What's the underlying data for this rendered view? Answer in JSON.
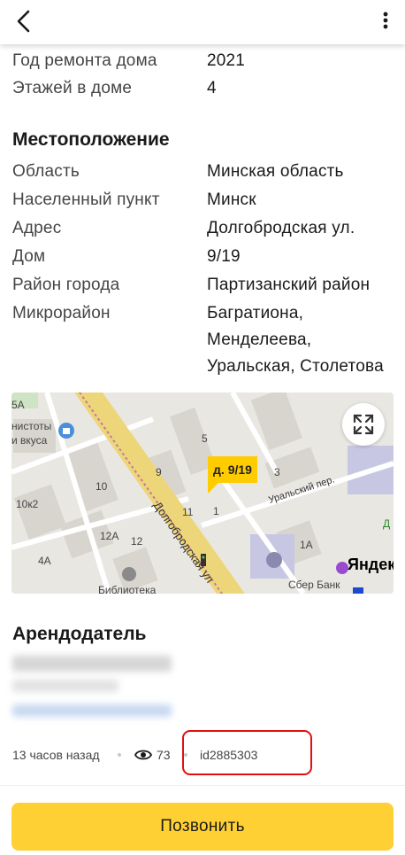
{
  "building": {
    "repair_label": "Год ремонта дома",
    "repair_value": "2021",
    "floors_label": "Этажей в доме",
    "floors_value": "4"
  },
  "location": {
    "title": "Местоположение",
    "rows": [
      {
        "label": "Область",
        "value": "Минская область"
      },
      {
        "label": "Населенный пункт",
        "value": "Минск"
      },
      {
        "label": "Адрес",
        "value": "Долгобродская ул."
      },
      {
        "label": "Дом",
        "value": "9/19"
      },
      {
        "label": "Район города",
        "value": "Партизанский район"
      },
      {
        "label": "Микрорайон",
        "value_lines": [
          "Багратиона,",
          "Менделеева,",
          "Уральская, Столетова"
        ]
      }
    ]
  },
  "map": {
    "pin_label": "д. 9/19",
    "street_main": "Долгобродская ул",
    "street_side": "Уральский пер.",
    "labels": [
      "5А",
      "нистоты",
      "и вкуса",
      "9",
      "5",
      "3",
      "1",
      "11",
      "10",
      "10к2",
      "12А",
      "12",
      "4А",
      "1А",
      "Библиотека",
      "Сбер Банк",
      "Д"
    ],
    "brand": "Яндекс"
  },
  "landlord": {
    "title": "Арендодатель"
  },
  "meta": {
    "time": "13 часов назад",
    "views": "73",
    "id": "id2885303"
  },
  "actions": {
    "call_label": "Позвонить"
  },
  "colors": {
    "accent": "#ffd033",
    "pin": "#ffcc00",
    "highlight": "#e01010"
  }
}
